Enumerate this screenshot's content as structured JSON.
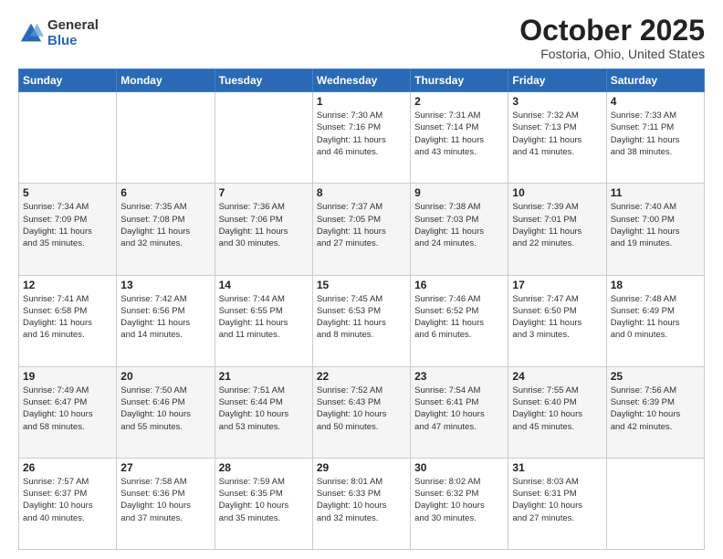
{
  "logo": {
    "general": "General",
    "blue": "Blue"
  },
  "title": "October 2025",
  "location": "Fostoria, Ohio, United States",
  "days_of_week": [
    "Sunday",
    "Monday",
    "Tuesday",
    "Wednesday",
    "Thursday",
    "Friday",
    "Saturday"
  ],
  "weeks": [
    [
      {
        "day": "",
        "info": ""
      },
      {
        "day": "",
        "info": ""
      },
      {
        "day": "",
        "info": ""
      },
      {
        "day": "1",
        "info": "Sunrise: 7:30 AM\nSunset: 7:16 PM\nDaylight: 11 hours\nand 46 minutes."
      },
      {
        "day": "2",
        "info": "Sunrise: 7:31 AM\nSunset: 7:14 PM\nDaylight: 11 hours\nand 43 minutes."
      },
      {
        "day": "3",
        "info": "Sunrise: 7:32 AM\nSunset: 7:13 PM\nDaylight: 11 hours\nand 41 minutes."
      },
      {
        "day": "4",
        "info": "Sunrise: 7:33 AM\nSunset: 7:11 PM\nDaylight: 11 hours\nand 38 minutes."
      }
    ],
    [
      {
        "day": "5",
        "info": "Sunrise: 7:34 AM\nSunset: 7:09 PM\nDaylight: 11 hours\nand 35 minutes."
      },
      {
        "day": "6",
        "info": "Sunrise: 7:35 AM\nSunset: 7:08 PM\nDaylight: 11 hours\nand 32 minutes."
      },
      {
        "day": "7",
        "info": "Sunrise: 7:36 AM\nSunset: 7:06 PM\nDaylight: 11 hours\nand 30 minutes."
      },
      {
        "day": "8",
        "info": "Sunrise: 7:37 AM\nSunset: 7:05 PM\nDaylight: 11 hours\nand 27 minutes."
      },
      {
        "day": "9",
        "info": "Sunrise: 7:38 AM\nSunset: 7:03 PM\nDaylight: 11 hours\nand 24 minutes."
      },
      {
        "day": "10",
        "info": "Sunrise: 7:39 AM\nSunset: 7:01 PM\nDaylight: 11 hours\nand 22 minutes."
      },
      {
        "day": "11",
        "info": "Sunrise: 7:40 AM\nSunset: 7:00 PM\nDaylight: 11 hours\nand 19 minutes."
      }
    ],
    [
      {
        "day": "12",
        "info": "Sunrise: 7:41 AM\nSunset: 6:58 PM\nDaylight: 11 hours\nand 16 minutes."
      },
      {
        "day": "13",
        "info": "Sunrise: 7:42 AM\nSunset: 6:56 PM\nDaylight: 11 hours\nand 14 minutes."
      },
      {
        "day": "14",
        "info": "Sunrise: 7:44 AM\nSunset: 6:55 PM\nDaylight: 11 hours\nand 11 minutes."
      },
      {
        "day": "15",
        "info": "Sunrise: 7:45 AM\nSunset: 6:53 PM\nDaylight: 11 hours\nand 8 minutes."
      },
      {
        "day": "16",
        "info": "Sunrise: 7:46 AM\nSunset: 6:52 PM\nDaylight: 11 hours\nand 6 minutes."
      },
      {
        "day": "17",
        "info": "Sunrise: 7:47 AM\nSunset: 6:50 PM\nDaylight: 11 hours\nand 3 minutes."
      },
      {
        "day": "18",
        "info": "Sunrise: 7:48 AM\nSunset: 6:49 PM\nDaylight: 11 hours\nand 0 minutes."
      }
    ],
    [
      {
        "day": "19",
        "info": "Sunrise: 7:49 AM\nSunset: 6:47 PM\nDaylight: 10 hours\nand 58 minutes."
      },
      {
        "day": "20",
        "info": "Sunrise: 7:50 AM\nSunset: 6:46 PM\nDaylight: 10 hours\nand 55 minutes."
      },
      {
        "day": "21",
        "info": "Sunrise: 7:51 AM\nSunset: 6:44 PM\nDaylight: 10 hours\nand 53 minutes."
      },
      {
        "day": "22",
        "info": "Sunrise: 7:52 AM\nSunset: 6:43 PM\nDaylight: 10 hours\nand 50 minutes."
      },
      {
        "day": "23",
        "info": "Sunrise: 7:54 AM\nSunset: 6:41 PM\nDaylight: 10 hours\nand 47 minutes."
      },
      {
        "day": "24",
        "info": "Sunrise: 7:55 AM\nSunset: 6:40 PM\nDaylight: 10 hours\nand 45 minutes."
      },
      {
        "day": "25",
        "info": "Sunrise: 7:56 AM\nSunset: 6:39 PM\nDaylight: 10 hours\nand 42 minutes."
      }
    ],
    [
      {
        "day": "26",
        "info": "Sunrise: 7:57 AM\nSunset: 6:37 PM\nDaylight: 10 hours\nand 40 minutes."
      },
      {
        "day": "27",
        "info": "Sunrise: 7:58 AM\nSunset: 6:36 PM\nDaylight: 10 hours\nand 37 minutes."
      },
      {
        "day": "28",
        "info": "Sunrise: 7:59 AM\nSunset: 6:35 PM\nDaylight: 10 hours\nand 35 minutes."
      },
      {
        "day": "29",
        "info": "Sunrise: 8:01 AM\nSunset: 6:33 PM\nDaylight: 10 hours\nand 32 minutes."
      },
      {
        "day": "30",
        "info": "Sunrise: 8:02 AM\nSunset: 6:32 PM\nDaylight: 10 hours\nand 30 minutes."
      },
      {
        "day": "31",
        "info": "Sunrise: 8:03 AM\nSunset: 6:31 PM\nDaylight: 10 hours\nand 27 minutes."
      },
      {
        "day": "",
        "info": ""
      }
    ]
  ]
}
